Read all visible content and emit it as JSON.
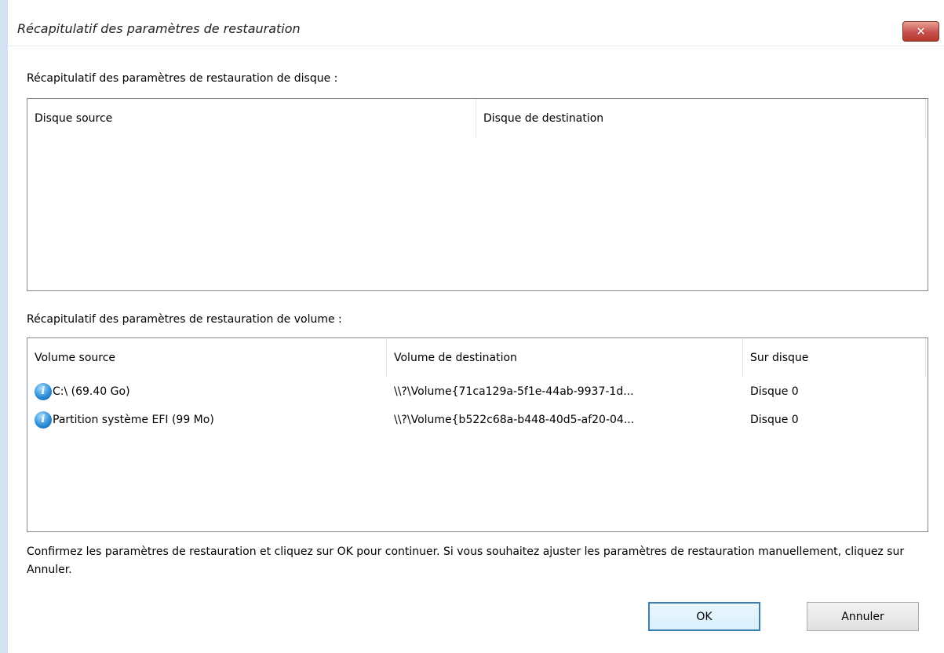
{
  "window": {
    "title": "Récapitulatif des paramètres de restauration"
  },
  "disk_section": {
    "label": "Récapitulatif des paramètres de restauration de disque :",
    "columns": [
      "Disque source",
      "Disque de destination"
    ]
  },
  "volume_section": {
    "label": "Récapitulatif des paramètres de restauration de volume :",
    "columns": [
      "Volume source",
      "Volume de destination",
      "Sur disque"
    ],
    "rows": [
      {
        "icon": "info-icon",
        "source": "C:\\ (69.40 Go)",
        "destination": "\\\\?\\Volume{71ca129a-5f1e-44ab-9937-1d...",
        "disk": "Disque 0"
      },
      {
        "icon": "info-icon",
        "source": "Partition système EFI (99 Mo)",
        "destination": "\\\\?\\Volume{b522c68a-b448-40d5-af20-04...",
        "disk": "Disque 0"
      }
    ]
  },
  "description": "Confirmez les paramètres de restauration et cliquez sur OK pour continuer. Si vous souhaitez ajuster les paramètres de restauration manuellement, cliquez sur Annuler.",
  "buttons": {
    "ok": "OK",
    "cancel": "Annuler"
  },
  "icons": {
    "close": "close-icon",
    "row": "info-icon"
  },
  "colors": {
    "close_button": "#c75050",
    "window_border": "#d4e1f2",
    "default_button_border": "#3c7fb1"
  }
}
